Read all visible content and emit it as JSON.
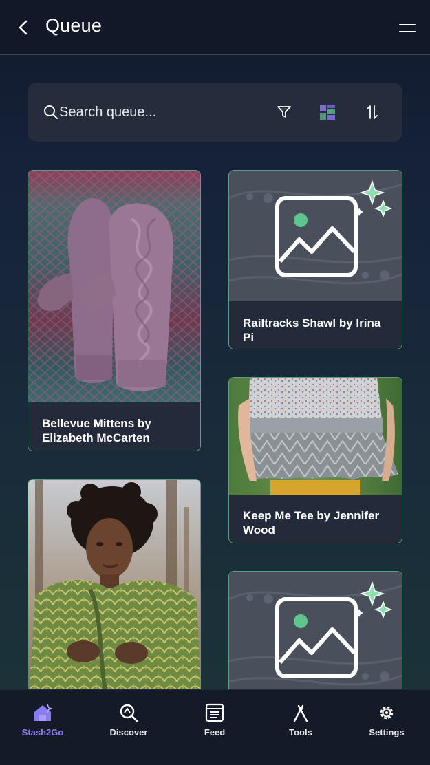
{
  "header": {
    "title": "Queue",
    "back_icon": "chevron-left-icon",
    "menu_icon": "hamburger-icon"
  },
  "search": {
    "placeholder": "Search queue...",
    "filter_icon": "filter-icon",
    "view_icon": "grid-view-icon",
    "sort_icon": "sort-icon"
  },
  "cards": [
    {
      "title": "Bellevue Mittens by Elizabeth McCarten",
      "image": "mittens-photo"
    },
    {
      "title": "Railtracks Shawl by Irina Pi",
      "image": "placeholder-image"
    },
    {
      "title": "Keep Me Tee by Jennifer Wood",
      "image": "tee-photo"
    },
    {
      "title": "",
      "image": "shawl-model-photo"
    },
    {
      "title": "",
      "image": "placeholder-image"
    }
  ],
  "tabs": [
    {
      "label": "Stash2Go",
      "icon": "home-icon",
      "active": true
    },
    {
      "label": "Discover",
      "icon": "discover-icon",
      "active": false
    },
    {
      "label": "Feed",
      "icon": "feed-icon",
      "active": false
    },
    {
      "label": "Tools",
      "icon": "tools-icon",
      "active": false
    },
    {
      "label": "Settings",
      "icon": "settings-icon",
      "active": false
    }
  ],
  "colors": {
    "accent": "#8a7cf0",
    "card_border": "#5f9c84",
    "card_bg": "#232a3a"
  }
}
